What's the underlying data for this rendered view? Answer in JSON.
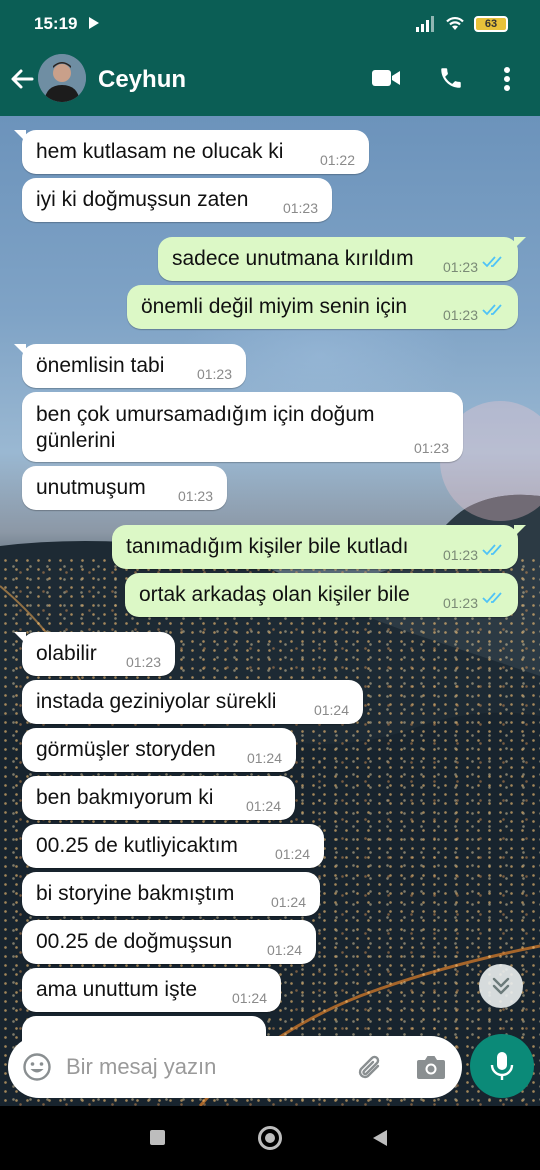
{
  "status_bar": {
    "time": "15:19",
    "battery": "63"
  },
  "header": {
    "contact_name": "Ceyhun"
  },
  "messages": [
    {
      "direction": "in",
      "text": "hem kutlasam ne olucak ki",
      "time": "01:22"
    },
    {
      "direction": "in",
      "text": "iyi ki doğmuşsun zaten",
      "time": "01:23"
    },
    {
      "direction": "out",
      "text": "sadece unutmana kırıldım",
      "time": "01:23",
      "status": "read"
    },
    {
      "direction": "out",
      "text": "önemli değil miyim senin için",
      "time": "01:23",
      "status": "read"
    },
    {
      "direction": "in",
      "text": "önemlisin tabi",
      "time": "01:23"
    },
    {
      "direction": "in",
      "text": "ben çok umursamadığım için doğum günlerini",
      "time": "01:23"
    },
    {
      "direction": "in",
      "text": "unutmuşum",
      "time": "01:23"
    },
    {
      "direction": "out",
      "text": "tanımadığım kişiler bile kutladı",
      "time": "01:23",
      "status": "read"
    },
    {
      "direction": "out",
      "text": "ortak arkadaş olan kişiler bile",
      "time": "01:23",
      "status": "read"
    },
    {
      "direction": "in",
      "text": "olabilir",
      "time": "01:23"
    },
    {
      "direction": "in",
      "text": "instada geziniyolar sürekli",
      "time": "01:24"
    },
    {
      "direction": "in",
      "text": "görmüşler storyden",
      "time": "01:24"
    },
    {
      "direction": "in",
      "text": "ben bakmıyorum ki",
      "time": "01:24"
    },
    {
      "direction": "in",
      "text": "00.25 de kutliyicaktım",
      "time": "01:24"
    },
    {
      "direction": "in",
      "text": "bi storyine bakmıştım",
      "time": "01:24"
    },
    {
      "direction": "in",
      "text": "00.25 de doğmuşsun",
      "time": "01:24"
    },
    {
      "direction": "in",
      "text": "ama unuttum işte",
      "time": "01:24"
    }
  ],
  "input": {
    "placeholder": "Bir mesaj yazın"
  },
  "colors": {
    "header_bg": "#0b5e55",
    "outgoing_bubble": "#dcf8c6",
    "incoming_bubble": "#ffffff",
    "read_ticks": "#4fc3f7",
    "mic_button": "#0b8a78"
  }
}
